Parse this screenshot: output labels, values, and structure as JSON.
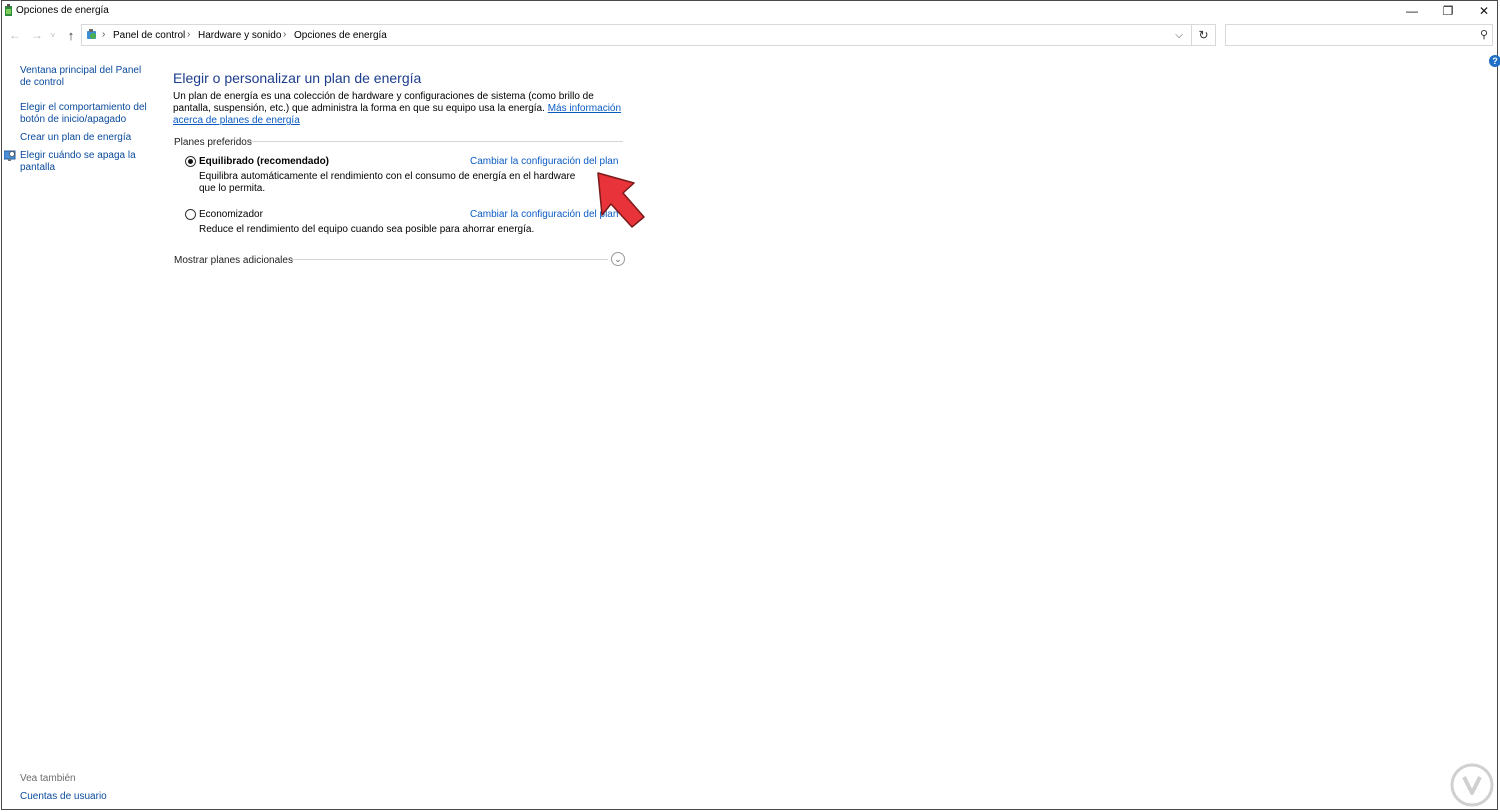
{
  "window": {
    "title": "Opciones de energía",
    "controls": {
      "minimize": "—",
      "maximize": "❐",
      "close": "✕"
    }
  },
  "nav": {
    "back": "←",
    "forward": "→",
    "recent": "˅",
    "up": "↑"
  },
  "address": {
    "breadcrumbs": [
      "Panel de control",
      "Hardware y sonido",
      "Opciones de energía"
    ],
    "separator": "›",
    "dropdown": "⌵",
    "refresh": "↻"
  },
  "search": {
    "placeholder": "",
    "icon": "⚲"
  },
  "help": {
    "label": "?"
  },
  "sidebar": {
    "links": [
      "Ventana principal del Panel de control",
      "Elegir el comportamiento del botón de inicio/apagado",
      "Crear un plan de energía",
      "Elegir cuándo se apaga la pantalla"
    ],
    "see_also_label": "Vea también",
    "see_also_links": [
      "Cuentas de usuario"
    ]
  },
  "main": {
    "heading": "Elegir o personalizar un plan de energía",
    "intro_text": "Un plan de energía es una colección de hardware y configuraciones de sistema (como brillo de pantalla, suspensión, etc.) que administra la forma en que su equipo usa la energía. ",
    "intro_link": "Más información acerca de planes de energía",
    "preferred_label": "Planes preferidos",
    "plans": [
      {
        "name": "Equilibrado (recomendado)",
        "selected": true,
        "description": "Equilibra automáticamente el rendimiento con el consumo de energía en el hardware que lo permita.",
        "link": "Cambiar la configuración del plan"
      },
      {
        "name": "Economizador",
        "selected": false,
        "description": "Reduce el rendimiento del equipo cuando sea posible para ahorrar energía.",
        "link": "Cambiar la configuración del plan"
      }
    ],
    "more_plans_label": "Mostrar planes adicionales",
    "expand_icon": "⌄"
  },
  "colors": {
    "link": "#0a5bc4",
    "heading": "#1c3d8c",
    "annotation_arrow": "#e8333a"
  }
}
